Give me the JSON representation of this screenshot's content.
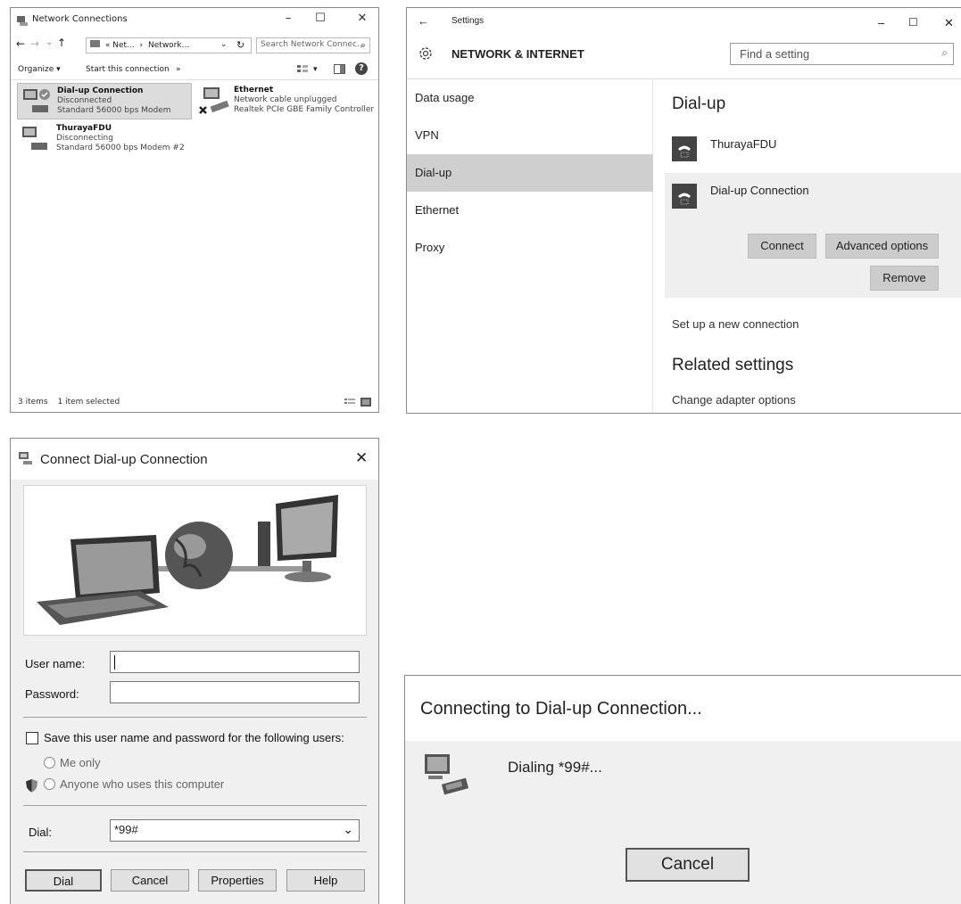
{
  "network_connections": {
    "title": "Network Connections",
    "min": "–",
    "max": "☐",
    "close": "✕",
    "nav": {
      "back": "←",
      "forward": "→",
      "dropdown": "⌄",
      "up": "↑"
    },
    "address": {
      "prefix": "«",
      "crumb1": "Net...",
      "sep": "›",
      "crumb2": "Network...",
      "arrow": "⌄",
      "refresh": "↻"
    },
    "search_placeholder": "Search Network Connec...",
    "search_glyph": "⌕",
    "toolbar": {
      "organize": "Organize ▾",
      "start": "Start this connection",
      "more": "»",
      "view": "▾",
      "help": "?"
    },
    "items": [
      {
        "name": "Dial-up Connection",
        "status": "Disconnected",
        "device": "Standard 56000 bps Modem"
      },
      {
        "name": "Ethernet",
        "status": "Network cable unplugged",
        "device": "Realtek PCIe GBE Family Controller"
      },
      {
        "name": "ThurayaFDU",
        "status": "Disconnecting",
        "device": "Standard 56000 bps Modem #2"
      }
    ],
    "status": {
      "count": "3 items",
      "selected": "1 item selected"
    }
  },
  "settings": {
    "back": "←",
    "title": "Settings",
    "min": "–",
    "max": "☐",
    "close": "✕",
    "section": "NETWORK & INTERNET",
    "find_placeholder": "Find a setting",
    "nav": [
      "Data usage",
      "VPN",
      "Dial-up",
      "Ethernet",
      "Proxy"
    ],
    "heading": "Dial-up",
    "connections": [
      "ThurayaFDU",
      "Dial-up Connection"
    ],
    "buttons": {
      "connect": "Connect",
      "advanced": "Advanced options",
      "remove": "Remove"
    },
    "setup_link": "Set up a new connection",
    "related_heading": "Related settings",
    "adapter_link": "Change adapter options"
  },
  "connect_dialog": {
    "title": "Connect Dial-up Connection",
    "close": "✕",
    "username_label": "User name:",
    "username_value": "",
    "password_label": "Password:",
    "password_value": "",
    "save_label": "Save this user name and password for the following users:",
    "me_only": "Me only",
    "anyone": "Anyone who uses this computer",
    "dial_label": "Dial:",
    "dial_value": "*99#",
    "dial_arrow": "⌄",
    "buttons": {
      "dial": "Dial",
      "cancel": "Cancel",
      "properties": "Properties",
      "help": "Help"
    }
  },
  "connecting": {
    "title": "Connecting to Dial-up Connection...",
    "message": "Dialing *99#...",
    "cancel": "Cancel"
  },
  "colors": {
    "selection": "#cfcfcf",
    "button_gray": "#cccccc",
    "dialog_bg": "#f0f0f0"
  }
}
